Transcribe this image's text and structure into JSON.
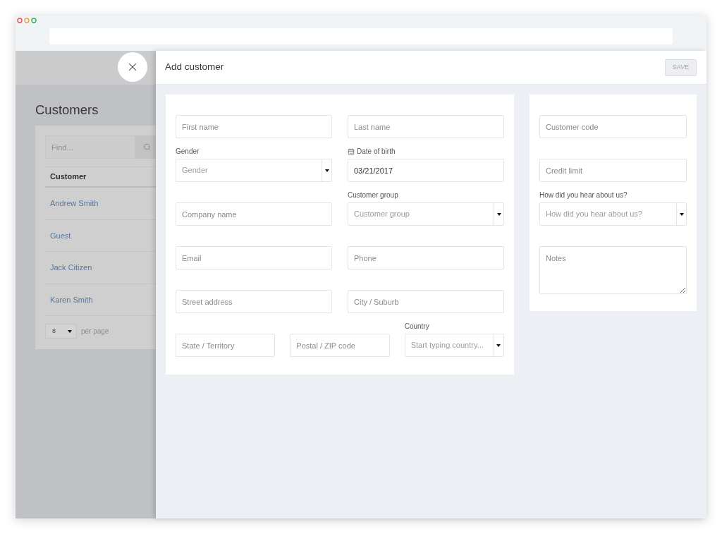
{
  "customers_page": {
    "title": "Customers",
    "search": {
      "placeholder": "Find..."
    },
    "table": {
      "columns": [
        "Customer"
      ],
      "rows": [
        {
          "customer": "Andrew Smith"
        },
        {
          "customer": "Guest"
        },
        {
          "customer": "Jack Citizen"
        },
        {
          "customer": "Karen Smith"
        }
      ]
    },
    "pagination": {
      "per_page": "8",
      "label": "per page"
    }
  },
  "add_customer_panel": {
    "title": "Add customer",
    "save_button": {
      "label": "SAVE",
      "disabled": true
    },
    "main_form": {
      "rows": [
        {
          "fields": [
            {
              "kind": "text",
              "placeholder": "First name"
            },
            {
              "kind": "text",
              "placeholder": "Last name"
            }
          ]
        },
        {
          "fields": [
            {
              "kind": "select",
              "label": "Gender",
              "placeholder": "Gender"
            },
            {
              "kind": "date",
              "label": "Date of birth",
              "value": "03/21/2017"
            }
          ]
        },
        {
          "fields": [
            {
              "kind": "text",
              "placeholder": "Company name"
            },
            {
              "kind": "select",
              "label": "Customer group",
              "placeholder": "Customer group"
            }
          ]
        },
        {
          "fields": [
            {
              "kind": "text",
              "placeholder": "Email"
            },
            {
              "kind": "text",
              "placeholder": "Phone"
            }
          ]
        },
        {
          "fields": [
            {
              "kind": "text",
              "placeholder": "Street address"
            },
            {
              "kind": "text",
              "placeholder": "City / Suburb"
            }
          ]
        },
        {
          "fields": [
            {
              "kind": "text",
              "placeholder": "State / Territory"
            },
            {
              "kind": "text",
              "placeholder": "Postal / ZIP code"
            },
            {
              "kind": "select",
              "label": "Country",
              "placeholder": "Start typing country..."
            }
          ]
        }
      ]
    },
    "side_form": {
      "fields": [
        {
          "kind": "text",
          "placeholder": "Customer code"
        },
        {
          "kind": "text",
          "placeholder": "Credit limit"
        },
        {
          "kind": "select",
          "label": "How did you hear about us?",
          "placeholder": "How did you hear about us?"
        },
        {
          "kind": "textarea",
          "placeholder": "Notes"
        }
      ]
    }
  }
}
